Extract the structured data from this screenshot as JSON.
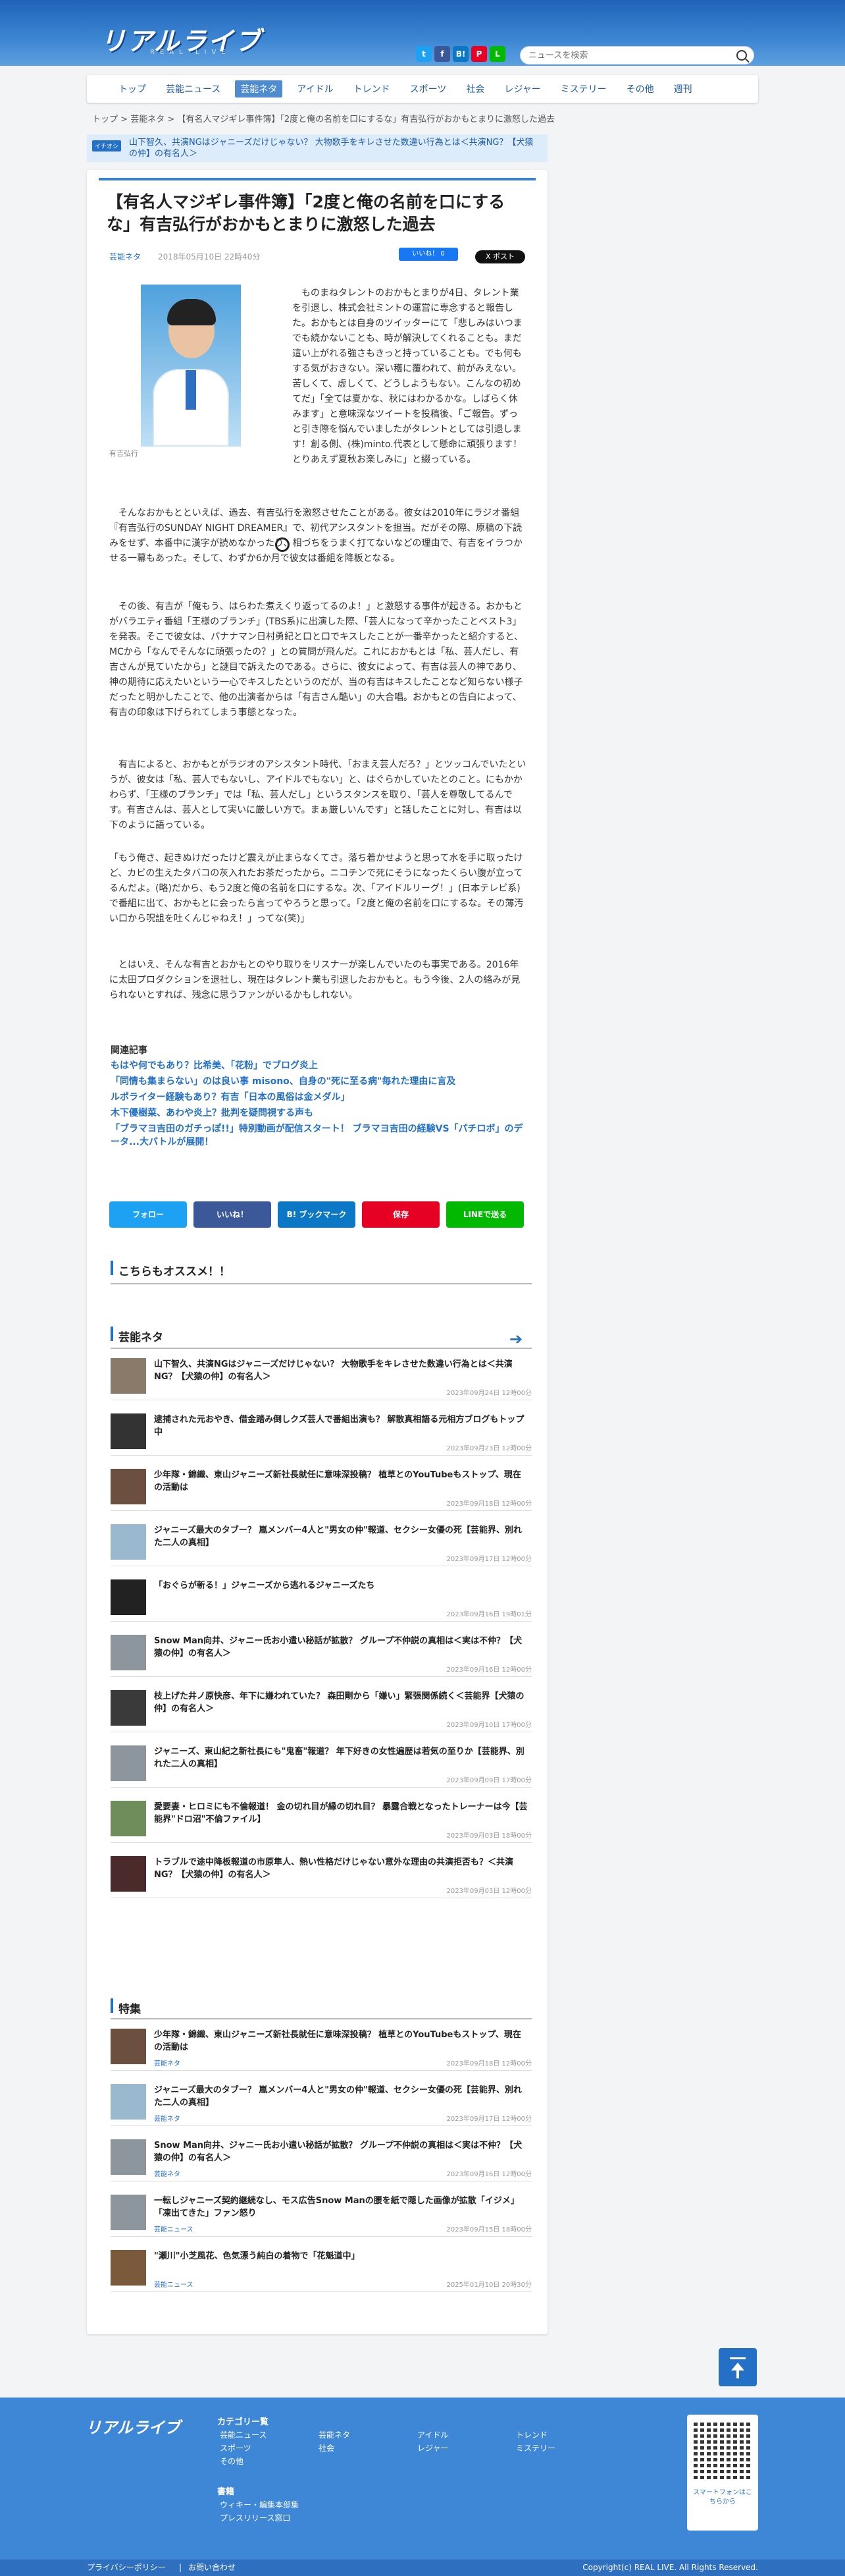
{
  "site": {
    "logo": "リアルライブ",
    "logo_sub": "REAL LIVE"
  },
  "search": {
    "placeholder": "ニュースを検索"
  },
  "social": [
    {
      "icon": "twitter-icon",
      "label": "t",
      "color": "#1da1f2"
    },
    {
      "icon": "facebook-icon",
      "label": "f",
      "color": "#3b5998"
    },
    {
      "icon": "hatena-icon",
      "label": "B!",
      "color": "#0b77c5"
    },
    {
      "icon": "pinterest-icon",
      "label": "P",
      "color": "#e60023"
    },
    {
      "icon": "line-icon",
      "label": "L",
      "color": "#00b900"
    }
  ],
  "nav": [
    "トップ",
    "芸能ニュース",
    "芸能ネタ",
    "アイドル",
    "トレンド",
    "スポーツ",
    "社会",
    "レジャー",
    "ミステリー",
    "その他",
    "週刊"
  ],
  "nav_active": 2,
  "breadcrumb": [
    "トップ",
    "芸能ネタ",
    "【有名人マジギレ事件簿】「2度と俺の名前を口にするな」有吉弘行がおかもとまりに激怒した過去"
  ],
  "ticker": {
    "tag": "イチオシ",
    "text": "山下智久、共演NGはジャニーズだけじゃない？ 大物歌手をキレさせた数違い行為とは＜共演NG？【犬猿の仲】の有名人＞"
  },
  "article": {
    "title": "【有名人マジギレ事件簿】「2度と俺の名前を口にするな」有吉弘行がおかもとまりに激怒した過去",
    "category": "芸能ネタ",
    "date": "2018年05月10日 22時40分",
    "like": "いいね！ 0",
    "post": "X ポスト",
    "caption": "有吉弘行",
    "paragraphs": [
      "ものまねタレントのおかもとまりが4日、タレント業を引退し、株式会社ミントの運営に専念すると報告した。おかもとは自身のツイッターにて「悲しみはいつまでも続かないことも、時が解決してくれることも。まだ這い上がれる強さもきっと持っていることも。でも何もする気がおきない。深い穫に覆われて、前がみえない。苦しくて、虚しくて、どうしようもない。こんなの初めてだ」「全ては夏かな、秋にはわかるかな。しばらく休みます」と意味深なツイートを投稿後、「ご報告。ずっと引き際を悩んでいましたがタレントとしては引退します！創る側、(株)minto.代表として懸命に頑張ります！とりあえず夏秋お楽しみに」と綴っている。",
      "そんなおかもとといえば、過去、有吉弘行を激怒させたことがある。彼女は2010年にラジオ番組『有吉弘行のSUNDAY NIGHT DREAMER』で、初代アシスタントを担当。だがその際、原稿の下読みをせず、本番中に漢字が読めなかったり、相づちをうまく打てないなどの理由で、有吉をイラつかせる一幕もあった。そして、わずか6か月で彼女は番組を降板となる。",
      "その後、有吉が「俺もう、はらわた煮えくり返ってるのよ！」と激怒する事件が起きる。おかもとがバラエティ番組「王様のブランチ」(TBS系)に出演した際、「芸人になって辛かったことベスト3」を発表。そこで彼女は、パナナマン日村勇紀と口と口でキスしたことが一番辛かったと紹介すると、MCから「なんでそんなに頑張ったの？」との質問が飛んだ。これにおかもとは「私、芸人だし、有吉さんが見ていたから」と謎目で訴えたのである。さらに、彼女によって、有吉は芸人の神であり、神の期待に応えたいという一心でキスしたというのだが、当の有吉はキスしたことなど知らない様子だったと明かしたことで、他の出演者からは「有吉さん酷い」の大合唱。おかもとの告白によって、有吉の印象は下げられてしまう事態となった。",
      "有吉によると、おかもとがラジオのアシスタント時代、「おまえ芸人だろ？」とツッコんでいたというが、彼女は「私、芸人でもないし、アイドルでもない」と、はぐらかしていたとのこと。にもかかわらず、「王様のブランチ」では「私、芸人だし」というスタンスを取り、「芸人を尊敬してるんです。有吉さんは、芸人として実いに厳しい方で。まぁ厳しいんです」と話したことに対し、有吉は以下のように語っている。",
      "「もう俺さ、起きぬけだったけど震えが止まらなくてさ。落ち着かせようと思って水を手に取ったけど、カビの生えたタバコの灰入れたお茶だったから。ニコチンで死にそうになったくらい腹が立ってるんだよ。(略)だから、もう2度と俺の名前を口にするな。次、「アイドルリーグ！」(日本テレビ系)で番組に出て、おかもとに会ったら言ってやろうと思って。「2度と俺の名前を口にするな。その薄汚い口から呪詛を吐くんじゃねえ！」ってな(笑)」",
      "とはいえ、そんな有吉とおかもとのやり取りをリスナーが楽しんでいたのも事実である。2016年に太田プロダクションを退社し、現在はタレント業も引退したおかもと。もう今後、2人の絡みが見られないとすれば、残念に思うファンがいるかもしれない。"
    ]
  },
  "related": {
    "heading": "関連記事",
    "items": [
      "もはや何でもあり？比希美、「花粉」でブログ炎上",
      "「同情も集まらない」のは良い事 misono、自身の\"死に至る病\"毎れた理由に言及",
      "ルポライター経験もあり？有吉「日本の風俗は金メダル」",
      "木下優樹菜、あわや炎上？批判を疑問視する声も",
      "「ブラマヨ吉田のガチっぽ!!」特別動画が配信スタート！ ブラマヨ吉田の経験VS「パチロボ」のデータ...大バトルが展開！"
    ]
  },
  "share": [
    {
      "label": "フォロー",
      "color": "#1da1f2"
    },
    {
      "label": "いいね！",
      "color": "#3b5998"
    },
    {
      "label": "B! ブックマーク",
      "color": "#0b77c5"
    },
    {
      "label": "保存",
      "color": "#e60023"
    },
    {
      "label": "LINEで送る",
      "color": "#00b900"
    }
  ],
  "recommend": {
    "title": "こちらもオススメ！！"
  },
  "geino": {
    "title": "芸能ネタ",
    "items": [
      {
        "title": "山下智久、共演NGはジャニーズだけじゃない？ 大物歌手をキレさせた数違い行為とは＜共演NG？【犬猿の仲】の有名人＞",
        "date": "2023年09月24日 12時00分"
      },
      {
        "title": "逮捕された元おやき、借金踏み倒しクズ芸人で番組出演も？ 解散真相語る元相方ブログもトップ中",
        "date": "2023年09月23日 12時00分"
      },
      {
        "title": "少年隊・錦織、東山ジャニーズ新社長就任に意味深投稿？ 植草とのYouTubeもストップ、現在の活動は",
        "date": "2023年09月18日 12時00分"
      },
      {
        "title": "ジャニーズ最大のタブー？ 嵐メンバー4人と\"男女の仲\"報道、セクシー女優の死【芸能界、別れた二人の真相】",
        "date": "2023年09月17日 12時00分"
      },
      {
        "title": "「おぐらが斬る！」ジャニーズから逃れるジャニーズたち",
        "date": "2023年09月16日 19時01分"
      },
      {
        "title": "Snow Man向井、ジャニー氏お小遣い秘話が拡散？ グループ不仲説の真相は＜実は不仲？【犬猿の仲】の有名人＞",
        "date": "2023年09月16日 12時00分"
      },
      {
        "title": "枝上げた井ノ原快彦、年下に嫌われていた？ 森田剛から「嫌い」緊張関係続く＜芸能界【犬猿の仲】の有名人＞",
        "date": "2023年09月10日 17時00分"
      },
      {
        "title": "ジャニーズ、東山紀之新社長にも\"鬼畜\"報道？ 年下好きの女性遍歴は若気の至りか【芸能界、別れた二人の真相】",
        "date": "2023年09月09日 17時00分"
      },
      {
        "title": "愛要妻・ヒロミにも不倫報道！ 金の切れ目が縁の切れ目？ 暴露合戦となったトレーナーは今【芸能界\"ドロ沼\"不倫ファイル】",
        "date": "2023年09月03日 18時00分"
      },
      {
        "title": "トラブルで途中降板報道の市原隼人、熱い性格だけじゃない意外な理由の共演拒否も？＜共演NG？【犬猿の仲】の有名人＞",
        "date": "2023年09月03日 12時00分"
      }
    ]
  },
  "special": {
    "title": "特集",
    "items": [
      {
        "title": "少年隊・錦織、東山ジャニーズ新社長就任に意味深投稿？ 植草とのYouTubeもストップ、現在の活動は",
        "cat": "芸能ネタ",
        "date": "2023年09月18日 12時00分"
      },
      {
        "title": "ジャニーズ最大のタブー？ 嵐メンバー4人と\"男女の仲\"報道、セクシー女優の死【芸能界、別れた二人の真相】",
        "cat": "芸能ネタ",
        "date": "2023年09月17日 12時00分"
      },
      {
        "title": "Snow Man向井、ジャニー氏お小遣い秘話が拡散？ グループ不仲説の真相は＜実は不仲？【犬猿の仲】の有名人＞",
        "cat": "芸能ネタ",
        "date": "2023年09月16日 12時00分"
      },
      {
        "title": "一転しジャニーズ契約継続なし、モス広告Snow Manの腰を紙で隠した画像が拡散「イジメ」「凍出てきた」ファン怒り",
        "cat": "芸能ニュース",
        "date": "2023年09月15日 18時00分"
      },
      {
        "title": "\"瀬川\"小芝風花、色気漂う純白の着物で「花魁道中」",
        "cat": "芸能ニュース",
        "date": "2025年01月10日 20時30分"
      }
    ]
  },
  "footer": {
    "logo": "リアルライブ",
    "category_heading": "カテゴリー覧",
    "categories": [
      "芸能ニュース",
      "芸能ネタ",
      "アイドル",
      "トレンド",
      "スポーツ",
      "社会",
      "レジャー",
      "ミステリー",
      "その他"
    ],
    "books_heading": "書籍",
    "books": [
      "ウィキー・編集本部集",
      "プレスリリース窓口"
    ],
    "qr_text": "スマートフォンはこちらから",
    "policy": "プライバシーポリシー",
    "contact": "お問い合わせ",
    "copyright": "Copyright(c) REAL LIVE. All Rights Reserved."
  }
}
